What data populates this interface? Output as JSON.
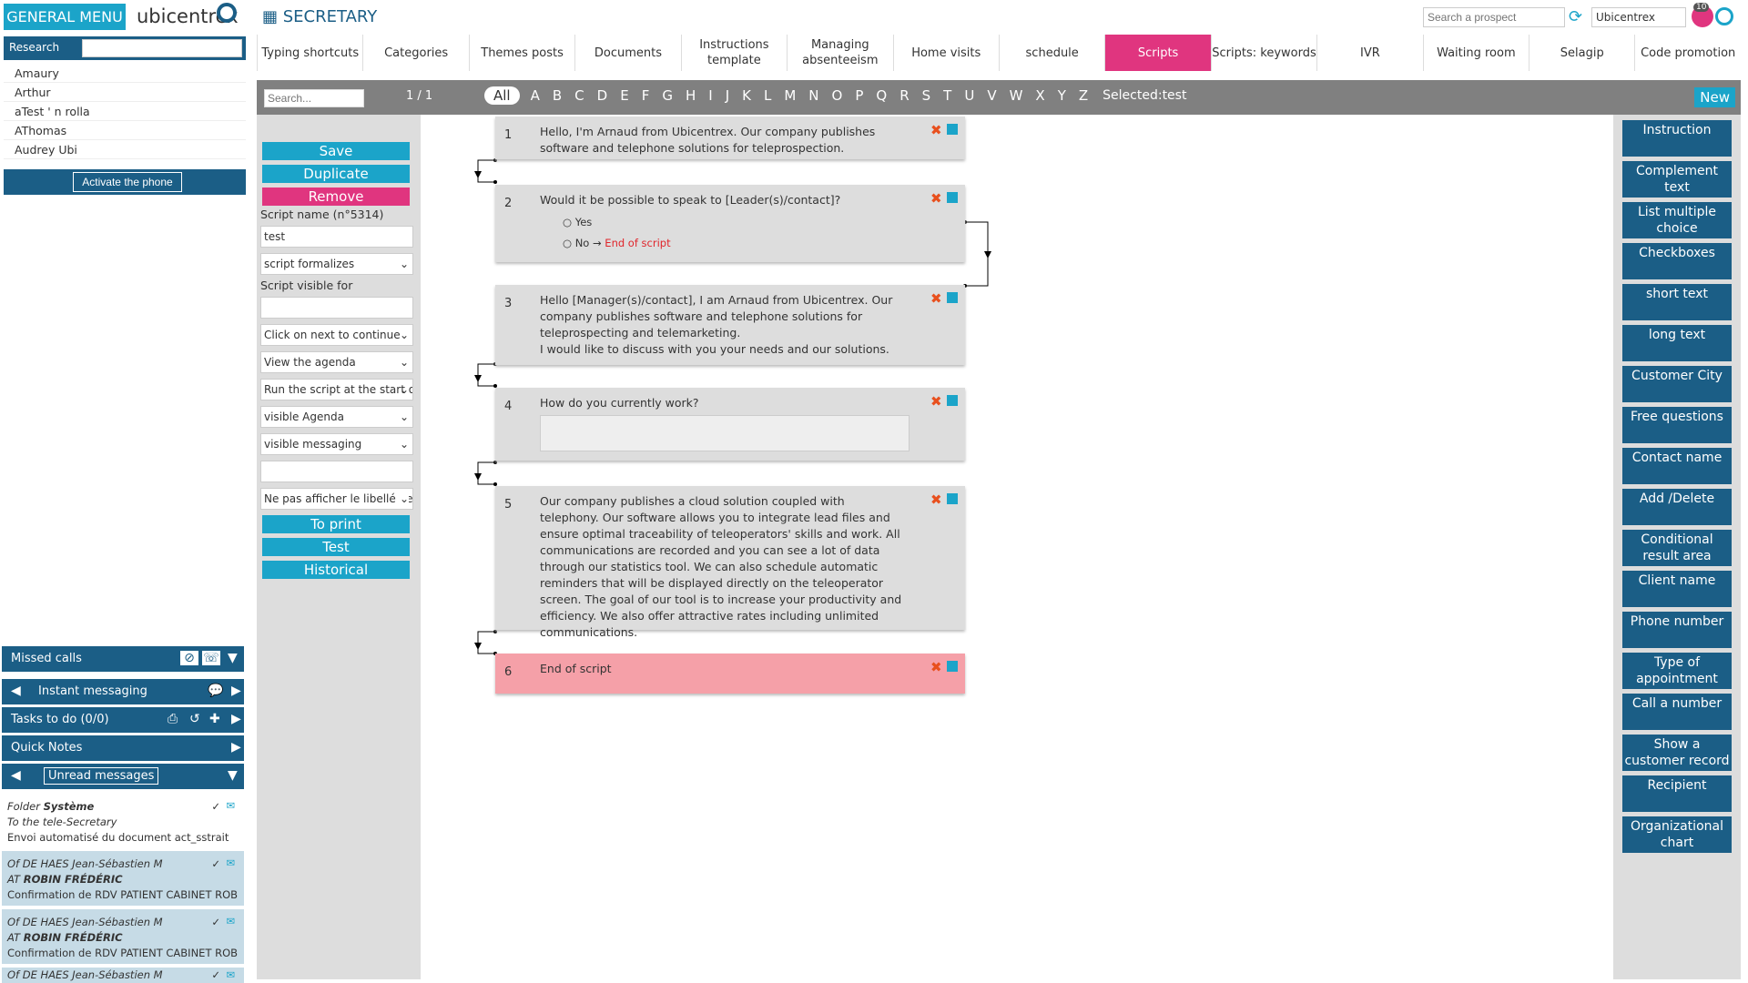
{
  "app": {
    "general_menu": "GENERAL MENU",
    "logo": "ubicentrex",
    "section_title": "SECRETARY"
  },
  "header": {
    "search_placeholder": "Search a prospect",
    "account": "Ubicentrex",
    "badge": "10"
  },
  "sidebar": {
    "research_label": "Research",
    "users": [
      "Amaury",
      "Arthur",
      "aTest ' n rolla",
      "AThomas",
      "Audrey Ubi"
    ],
    "activate_phone": "Activate the phone",
    "missed_calls": "Missed calls",
    "instant_messaging": "Instant messaging",
    "tasks": "Tasks to do (0/0)",
    "quick_notes": "Quick Notes",
    "unread_messages": "Unread messages",
    "messages": [
      {
        "line1": "Folder",
        "line1b": "Système",
        "line2": "To the tele-Secretary",
        "line3": "Envoi automatisé du document act_sstrait"
      },
      {
        "line1": "Of DE HAES Jean-Sébastien M",
        "line1b": "",
        "line2": "AT",
        "line2b": "ROBIN FRÉDÉRIC",
        "line3": "Confirmation de RDV PATIENT CABINET ROB"
      },
      {
        "line1": "Of DE HAES Jean-Sébastien M",
        "line1b": "",
        "line2": "AT",
        "line2b": "ROBIN FRÉDÉRIC",
        "line3": "Confirmation de RDV PATIENT CABINET ROB"
      },
      {
        "line1": "Of DE HAES Jean-Sébastien M",
        "line1b": "",
        "line2": "",
        "line2b": "",
        "line3": ""
      }
    ]
  },
  "tabs": [
    "Typing shortcuts",
    "Categories",
    "Themes posts",
    "Documents",
    "Instructions template",
    "Managing absenteeism",
    "Home visits",
    "schedule",
    "Scripts",
    "Scripts: keywords",
    "IVR",
    "Waiting room",
    "Selagip",
    "Code promotion"
  ],
  "toolbar": {
    "search_placeholder": "Search...",
    "page": "1 / 1",
    "all": "All",
    "letters": [
      "A",
      "B",
      "C",
      "D",
      "E",
      "F",
      "G",
      "H",
      "I",
      "J",
      "K",
      "L",
      "M",
      "N",
      "O",
      "P",
      "Q",
      "R",
      "S",
      "T",
      "U",
      "V",
      "W",
      "X",
      "Y",
      "Z"
    ],
    "selected": "Selected:test",
    "new": "New"
  },
  "left_panel": {
    "save": "Save",
    "duplicate": "Duplicate",
    "remove": "Remove",
    "script_name_label": "Script name (n°5314)",
    "script_name": "test",
    "select_formalize": "script formalizes",
    "visible_for_label": "Script visible for",
    "select_next": "Click on next to continue",
    "select_agenda": "View the agenda",
    "select_run": "Run the script at the start o",
    "select_visible_agenda": "visible Agenda",
    "select_visible_messaging": "visible messaging",
    "select_label": "Ne pas afficher le libellé de",
    "print": "To print",
    "test": "Test",
    "historical": "Historical"
  },
  "cards": [
    {
      "num": "1",
      "text": "Hello, I'm Arnaud from Ubicentrex. Our company publishes software and telephone solutions for teleprospection."
    },
    {
      "num": "2",
      "text": "Would it be possible to speak to [Leader(s)/contact]?",
      "opt_yes": "Yes",
      "opt_no": "No",
      "goto": "End of script"
    },
    {
      "num": "3",
      "text": "Hello [Manager(s)/contact], I am Arnaud from Ubicentrex. Our company publishes software and telephone solutions for teleprospecting and telemarketing.",
      "text2": "I would like to discuss with you your needs and our solutions."
    },
    {
      "num": "4",
      "text": "How do you currently work?"
    },
    {
      "num": "5",
      "text": "Our company publishes a cloud solution coupled with telephony. Our software allows you to integrate lead files and ensure optimal traceability of teleoperators' skills and work. All communications are recorded and you can see a lot of data through our statistics tool. We can also schedule automatic reminders that will be displayed directly on the teleoperator screen. The goal of our tool is to increase your productivity and efficiency. We also offer attractive rates including unlimited communications."
    },
    {
      "num": "6",
      "text": "End of script"
    }
  ],
  "right_panel": [
    "Instruction",
    "Complement text",
    "List multiple choice",
    "Checkboxes",
    "short text",
    "long text",
    "Customer City",
    "Free questions",
    "Contact name",
    "Add /Delete",
    "Conditional result area",
    "Client name",
    "Phone number",
    "Type of appointment",
    "Call a number",
    "Show a customer record",
    "Recipient",
    "Organizational chart"
  ],
  "colors": {
    "primary": "#1b5e86",
    "accent": "#1ba4c9",
    "active_tab": "#e0357f",
    "end_card": "#f5a0a8"
  }
}
